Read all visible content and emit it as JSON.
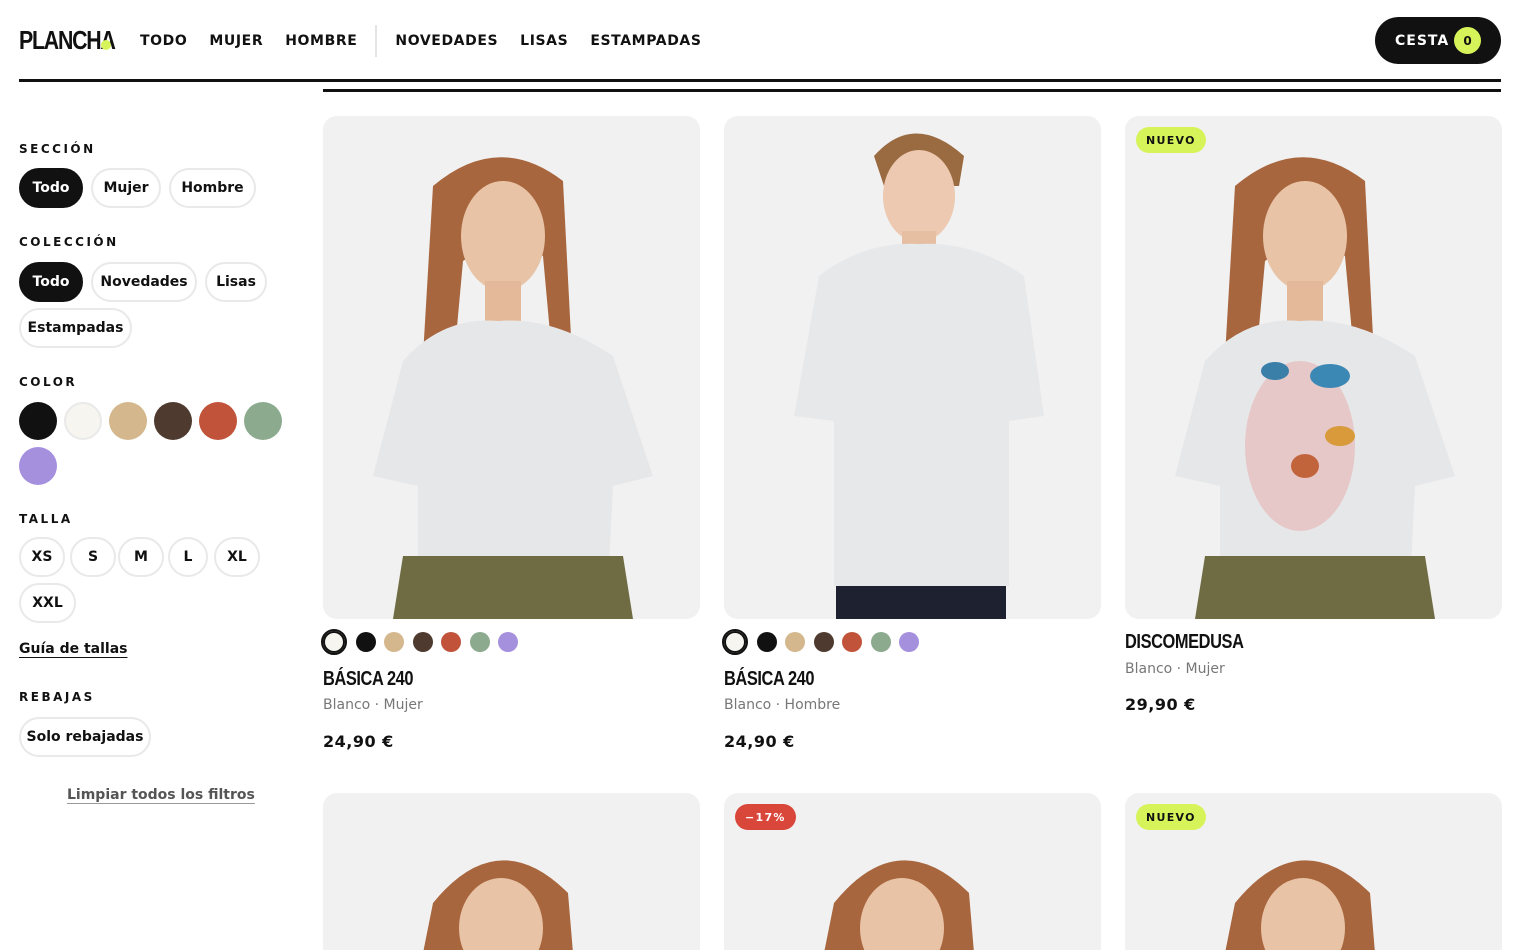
{
  "brand": {
    "name": "PLANCHA",
    "accent": "#d6f45a"
  },
  "nav": {
    "items": [
      "TODO",
      "MUJER",
      "HOMBRE",
      "NOVEDADES",
      "LISAS",
      "ESTAMPADAS"
    ],
    "active": "TODO"
  },
  "cart": {
    "label": "CESTA",
    "count": "0"
  },
  "filters": {
    "section": {
      "title": "SECCIÓN",
      "options": [
        "Todo",
        "Mujer",
        "Hombre"
      ],
      "selected": "Todo"
    },
    "collection": {
      "title": "COLECCIÓN",
      "options": [
        "Todo",
        "Novedades",
        "Lisas",
        "Estampadas"
      ],
      "selected": "Todo"
    },
    "color": {
      "title": "COLOR",
      "swatches": [
        "#111111",
        "#f6f5f0",
        "#d4b78c",
        "#4e3a2e",
        "#c0533a",
        "#8caa8e",
        "#a590de"
      ],
      "swatch_icons": [
        "black-swatch",
        "white-swatch",
        "beige-swatch",
        "brown-swatch",
        "rust-swatch",
        "sage-swatch",
        "lavender-swatch"
      ]
    },
    "size": {
      "title": "TALLA",
      "options": [
        "XS",
        "S",
        "M",
        "L",
        "XL",
        "XXL"
      ],
      "guide_link": "Guía de tallas"
    },
    "sale": {
      "title": "REBAJAS",
      "option": "Solo rebajadas"
    },
    "clear_link": "Limpiar todos los filtros"
  },
  "products": [
    {
      "name": "BÁSICA 240",
      "meta": "Blanco · Mujer",
      "price": "24,90 €",
      "badge": "",
      "image": "woman-plain-white-tshirt",
      "swatches": [
        "#f6f5f0",
        "#111111",
        "#d4b78c",
        "#4e3a2e",
        "#c0533a",
        "#8caa8e",
        "#a590de"
      ]
    },
    {
      "name": "BÁSICA 240",
      "meta": "Blanco · Hombre",
      "price": "24,90 €",
      "badge": "",
      "image": "man-plain-white-tshirt",
      "swatches": [
        "#f6f5f0",
        "#111111",
        "#d4b78c",
        "#4e3a2e",
        "#c0533a",
        "#8caa8e",
        "#a590de"
      ]
    },
    {
      "name": "DISCOMEDUSA",
      "meta": "Blanco · Mujer",
      "price": "29,90 €",
      "badge": "NUEVO",
      "image": "woman-jellyfish-print-tshirt",
      "swatches": []
    },
    {
      "badge": "",
      "image": "woman-tshirt"
    },
    {
      "badge": "−17%",
      "image": "woman-tshirt"
    },
    {
      "badge": "NUEVO",
      "image": "woman-tshirt"
    }
  ]
}
